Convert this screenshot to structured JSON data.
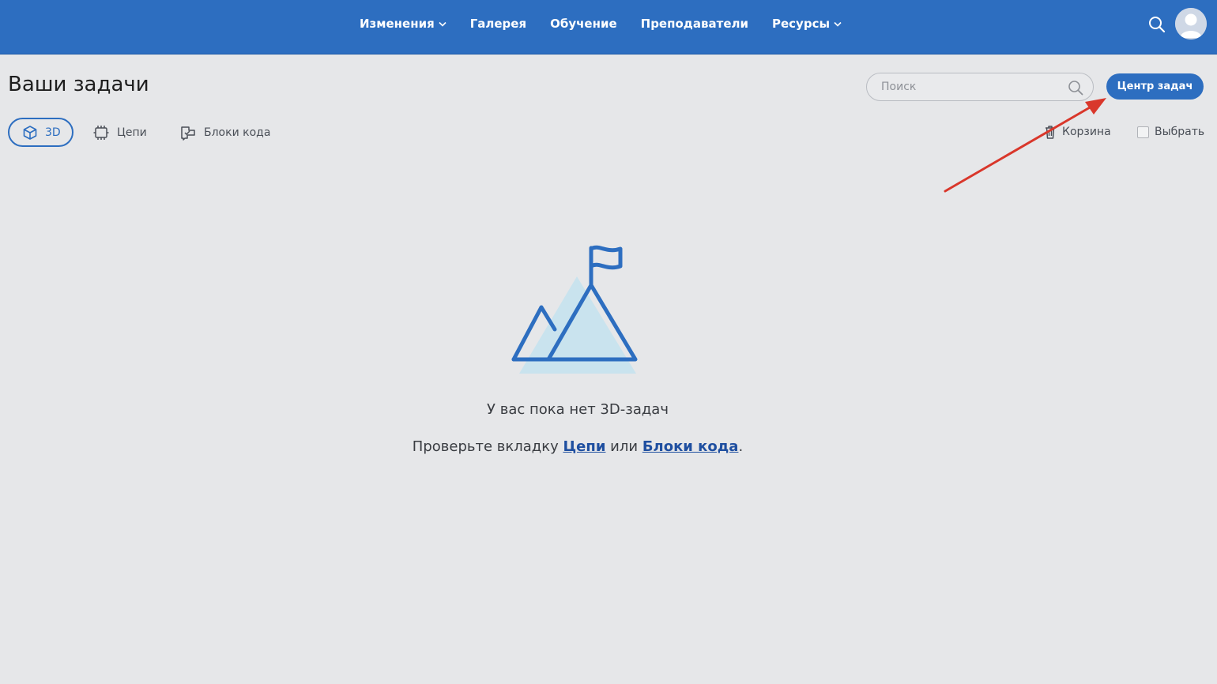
{
  "nav": {
    "items": [
      {
        "label": "Изменения",
        "has_dropdown": true
      },
      {
        "label": "Галерея",
        "has_dropdown": false
      },
      {
        "label": "Обучение",
        "has_dropdown": false
      },
      {
        "label": "Преподаватели",
        "has_dropdown": false
      },
      {
        "label": "Ресурсы",
        "has_dropdown": true
      }
    ],
    "search_icon": "search-icon",
    "avatar_icon": "user-avatar-icon"
  },
  "header": {
    "title": "Ваши задачи",
    "search_placeholder": "Поиск",
    "task_center_label": "Центр задач"
  },
  "tabs": [
    {
      "label": "3D",
      "icon": "cube-icon",
      "active": true
    },
    {
      "label": "Цепи",
      "icon": "chip-icon",
      "active": false
    },
    {
      "label": "Блоки кода",
      "icon": "code-blocks-icon",
      "active": false
    }
  ],
  "actions": {
    "trash_label": "Корзина",
    "select_label": "Выбрать"
  },
  "empty_state": {
    "title": "У вас пока нет 3D-задач",
    "hint_prefix": "Проверьте вкладку ",
    "hint_link1": "Цепи",
    "hint_middle": " или ",
    "hint_link2": "Блоки кода",
    "hint_suffix": "."
  },
  "colors": {
    "brand": "#2d6ec0",
    "background": "#e6e7e9",
    "annotation_arrow": "#d9372b",
    "illustration_fill": "#c9e3ee"
  }
}
